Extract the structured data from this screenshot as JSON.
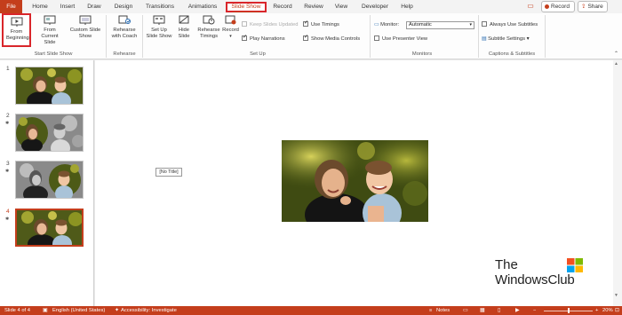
{
  "tabs": [
    {
      "label": "File",
      "key": "file"
    },
    {
      "label": "Home",
      "key": "home"
    },
    {
      "label": "Insert",
      "key": "insert"
    },
    {
      "label": "Draw",
      "key": "draw"
    },
    {
      "label": "Design",
      "key": "design"
    },
    {
      "label": "Transitions",
      "key": "transitions"
    },
    {
      "label": "Animations",
      "key": "animations"
    },
    {
      "label": "Slide Show",
      "key": "slideshow"
    },
    {
      "label": "Record",
      "key": "record"
    },
    {
      "label": "Review",
      "key": "review"
    },
    {
      "label": "View",
      "key": "view"
    },
    {
      "label": "Developer",
      "key": "developer"
    },
    {
      "label": "Help",
      "key": "help"
    }
  ],
  "toolbar": {
    "record_label": "Record",
    "share_label": "Share"
  },
  "ribbon": {
    "start": {
      "from_beginning": "From Beginning",
      "from_current": "From Current Slide",
      "custom": "Custom Slide Show",
      "group_label": "Start Slide Show"
    },
    "rehearse": {
      "coach": "Rehearse with Coach",
      "group_label": "Rehearse"
    },
    "setup": {
      "setup_show": "Set Up Slide Show",
      "hide_slide": "Hide Slide",
      "rehearse_timings": "Rehearse Timings",
      "record": "Record",
      "keep_updated": "Keep Slides Updated",
      "play_narrations": "Play Narrations",
      "use_timings": "Use Timings",
      "show_media_controls": "Show Media Controls",
      "group_label": "Set Up"
    },
    "monitors": {
      "monitor_label": "Monitor:",
      "monitor_value": "Automatic",
      "presenter_view": "Use Presenter View",
      "group_label": "Monitors"
    },
    "captions": {
      "always_subtitles": "Always Use Subtitles",
      "subtitle_settings": "Subtitle Settings",
      "group_label": "Captions & Subtitles"
    }
  },
  "thumbnails": [
    {
      "num": "1"
    },
    {
      "num": "2"
    },
    {
      "num": "3"
    },
    {
      "num": "4"
    }
  ],
  "slide": {
    "title_placeholder": "[No Title]"
  },
  "watermark": {
    "line1": "The",
    "line2": "WindowsClub"
  },
  "status": {
    "slide_info": "Slide 4 of 4",
    "language": "English (United States)",
    "accessibility": "Accessibility: Investigate",
    "notes": "Notes",
    "zoom": "20%"
  },
  "colors": {
    "accent": "#c43e1c",
    "highlight": "#d9262b"
  }
}
